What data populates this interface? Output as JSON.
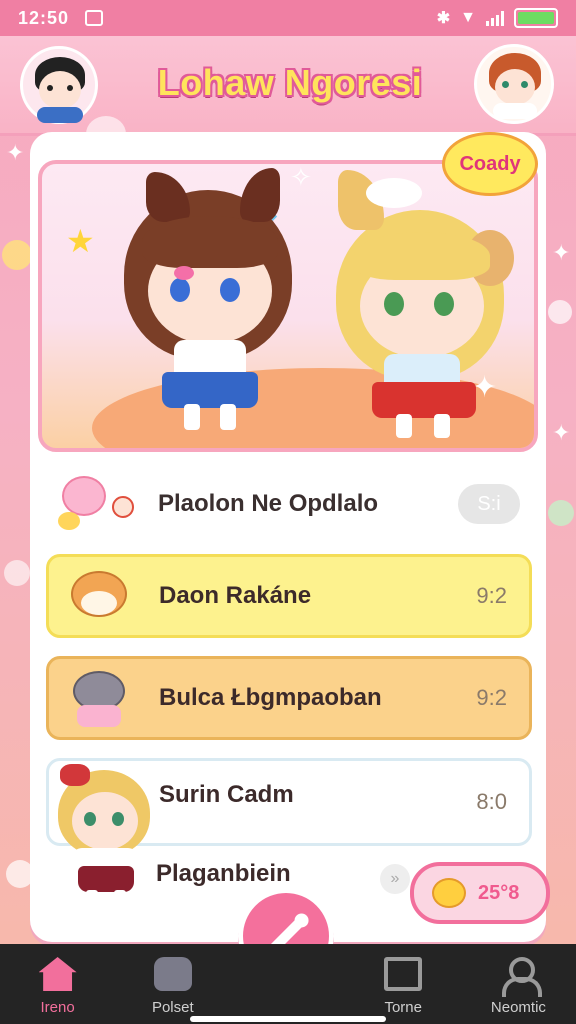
{
  "status_bar": {
    "time": "12:50"
  },
  "header": {
    "title": "Lohaw Ngoresi"
  },
  "hero": {
    "bubble_text": "Coady"
  },
  "list": [
    {
      "label": "Plaolon Ne Opdlalo",
      "value": "S:i"
    },
    {
      "label": "Daon Rakáne",
      "value": "9:2"
    },
    {
      "label": "Bulca Łbgmpaoban",
      "value": "9:2"
    },
    {
      "label": "Surin Cadm",
      "value": "8:0"
    }
  ],
  "extra": {
    "label": "Plaganbiein",
    "chip": "»",
    "temp": "25°8"
  },
  "nav": [
    {
      "label": "Ireno",
      "icon": "home-icon"
    },
    {
      "label": "Polset",
      "icon": "pet-icon"
    },
    {
      "label": "Torne",
      "icon": "square-icon"
    },
    {
      "label": "Neomtic",
      "icon": "person-icon"
    }
  ],
  "colors": {
    "accent": "#f26f9c",
    "header_bg": "#f9b3c6",
    "yellow_row": "#fdf28e",
    "orange_row": "#fbd28b"
  }
}
